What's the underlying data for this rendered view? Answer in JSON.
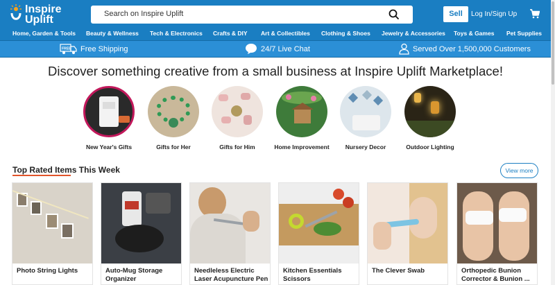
{
  "header": {
    "logo_line1": "Inspire",
    "logo_line2": "Uplift",
    "search_placeholder": "Search on Inspire Uplift",
    "sell_label": "Sell",
    "login_label": "Log In/Sign Up",
    "brand_color": "#1a7ec2"
  },
  "nav": {
    "items": [
      "Home, Garden & Tools",
      "Beauty & Wellness",
      "Tech & Electronics",
      "Crafts & DIY",
      "Art & Collectibles",
      "Clothing & Shoes",
      "Jewelry & Accessories",
      "Toys & Games",
      "Pet Supplies"
    ]
  },
  "benefits": {
    "items": [
      {
        "label": "Free Shipping",
        "icon": "free-shipping-truck-icon"
      },
      {
        "label": "24/7 Live Chat",
        "icon": "chat-bubble-icon"
      },
      {
        "label": "Served Over 1,500,000 Customers",
        "icon": "customers-icon"
      }
    ]
  },
  "headline": "Discover something creative from a small business at Inspire Uplift Marketplace!",
  "categories": [
    {
      "label": "New Year's Gifts"
    },
    {
      "label": "Gifts for Her"
    },
    {
      "label": "Gifts for Him"
    },
    {
      "label": "Home Improvement"
    },
    {
      "label": "Nursery Decor"
    },
    {
      "label": "Outdoor Lighting"
    }
  ],
  "top_rated": {
    "title": "Top Rated Items This Week",
    "view_more": "View more",
    "products": [
      {
        "name": "Photo String Lights"
      },
      {
        "name": "Auto-Mug Storage Organizer"
      },
      {
        "name": "Needleless Electric Laser Acupuncture Pen"
      },
      {
        "name": "Kitchen Essentials Scissors"
      },
      {
        "name": "The Clever Swab"
      },
      {
        "name": "Orthopedic Bunion Corrector & Bunion ..."
      }
    ]
  }
}
